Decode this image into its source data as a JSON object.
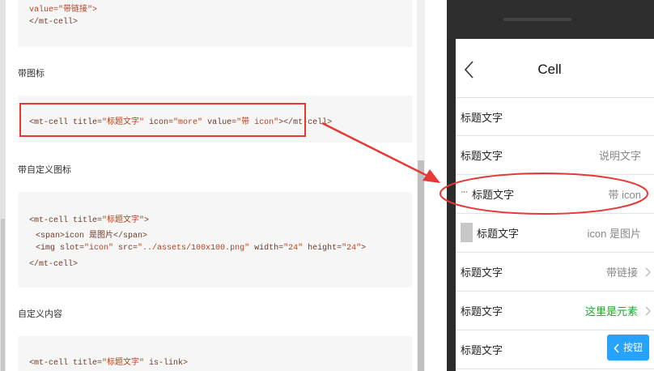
{
  "docs": {
    "top_code": {
      "line1": "value=\"带链接\">",
      "line2": "</mt-cell>"
    },
    "section_icon": {
      "title": "带图标",
      "code": {
        "open": "<mt-cell title=",
        "title_val": "\"标题文字\"",
        "icon_attr": " icon=",
        "icon_val": "\"more\"",
        "value_attr": " value=",
        "value_val": "\"带 icon\"",
        "close": "></mt-cell>"
      }
    },
    "section_custom_icon": {
      "title": "带自定义图标",
      "code": {
        "l1_open": "<mt-cell title=",
        "l1_title": "\"标题文字\"",
        "l1_close": ">",
        "l2": "<span>icon 是图片</span>",
        "l3_open": "<img slot=",
        "l3_slot": "\"icon\"",
        "l3_src_attr": " src=",
        "l3_src": "\"../assets/100x100.png\"",
        "l3_w_attr": " width=",
        "l3_w": "\"24\"",
        "l3_h_attr": " height=",
        "l3_h": "\"24\"",
        "l3_close": ">",
        "l4": "</mt-cell>"
      }
    },
    "section_custom_content": {
      "title": "自定义内容",
      "code": {
        "open": "<mt-cell title=",
        "title_val": "\"标题文字\"",
        "rest": " is-link>"
      }
    }
  },
  "phone": {
    "nav_title": "Cell",
    "cells": [
      {
        "title": "标题文字",
        "value": ""
      },
      {
        "title": "标题文字",
        "value": "说明文字"
      },
      {
        "title": "标题文字",
        "value": "带 icon",
        "icon": "more-icon",
        "icon_text": "···"
      },
      {
        "title": "标题文字",
        "value": "icon 是图片",
        "icon": "image-icon"
      },
      {
        "title": "标题文字",
        "value": "带链接",
        "chevron": true
      },
      {
        "title": "标题文字",
        "value": "这里是元素",
        "chevron": true
      },
      {
        "title": "标题文字",
        "button_label": "按钮",
        "button_icon": "chevron-left-icon"
      }
    ]
  },
  "colors": {
    "highlight": "#e53935",
    "green_value": "#26a22b",
    "button": "#26a2ff"
  }
}
